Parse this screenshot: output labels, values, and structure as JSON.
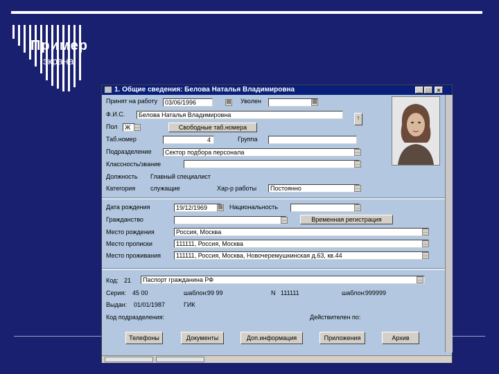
{
  "slide": {
    "title": "Пример",
    "subtitle": "экрана"
  },
  "window": {
    "title": "1. Общие сведения: Белова Наталья Владимировна",
    "controls": [
      "_",
      "□",
      "×"
    ]
  },
  "form": {
    "hire_label": "Принят на работу",
    "hire_date": "03/06/1996",
    "fired_label": "Уволен",
    "fired_value": "",
    "fio_label": "Ф.И.С.",
    "fio_value": "Белова Наталья Владимировна",
    "gender_label": "Пол",
    "gender_value": "Ж",
    "free_tab_button": "Свободные таб.номера",
    "tabnum_label": "Таб.номер",
    "tabnum_value": "4",
    "group_label": "Группа",
    "group_value": "",
    "dept_label": "Подразделение",
    "dept_value": "Сектор подбора персонала",
    "class_label": "Классность/звание",
    "class_value": "",
    "position_label": "Должность",
    "position_value": "Главный специалист",
    "category_label": "Категория",
    "category_value": "служащие",
    "worktype_label": "Хар-р работы",
    "worktype_value": "Постоянно",
    "birth_label": "Дата рождения",
    "birth_value": "19/12/1969",
    "nationality_label": "Национальность",
    "nationality_value": "",
    "citizenship_label": "Гражданство",
    "citizenship_value": "",
    "temp_reg_button": "Временная регистрация",
    "birthplace_label": "Место рождения",
    "birthplace_value": "Россия, Москва",
    "registration_label": "Место прописки",
    "registration_value": "111111, Россия, Москва",
    "residence_label": "Место проживания",
    "residence_value": "111111, Россия, Москва, Новочеремушкинская д.63, кв.44"
  },
  "document": {
    "code_label": "Код:",
    "code_value": "21",
    "type_value": "Паспорт гражданина РФ",
    "series_label": "Серия:",
    "series_value": "45 00",
    "series_template_label": "шаблон:",
    "series_template_value": "99 99",
    "number_label": "N",
    "number_value": "111111",
    "number_template_label": "шаблон:",
    "number_template_value": "999999",
    "issued_label": "Выдан:",
    "issued_date": "01/01/1987",
    "issuer": "ГИК",
    "subdivision_label": "Код подразделения:",
    "valid_label": "Действителен по:"
  },
  "buttons": {
    "phones": "Телефоны",
    "documents": "Документы",
    "extra": "Доп.информация",
    "attachments": "Приложения",
    "archive": "Архив"
  }
}
